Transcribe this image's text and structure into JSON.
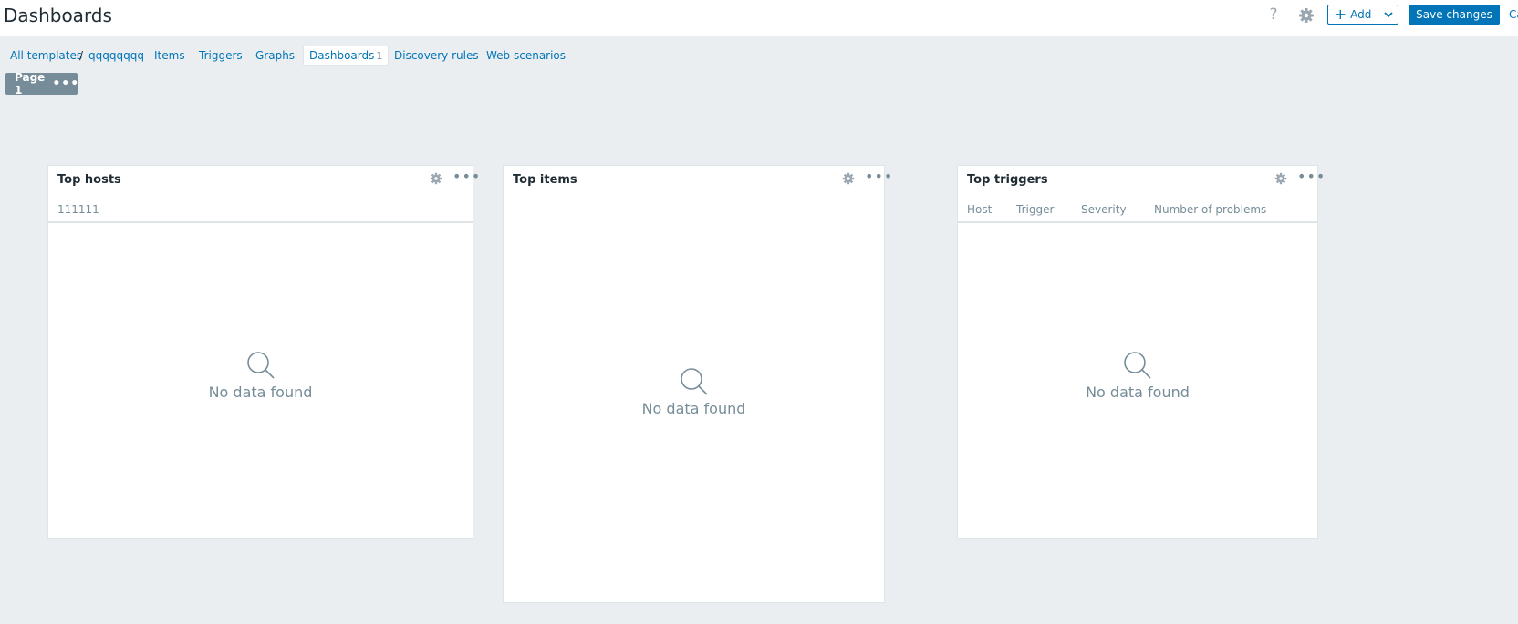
{
  "header": {
    "title": "Dashboards",
    "help_label": "?",
    "add_label": "Add",
    "save_label": "Save changes",
    "cancel_label": "Ca"
  },
  "nav": {
    "all_templates": "All templates",
    "separator": "/",
    "template_name": "qqqqqqqq",
    "items": "Items",
    "triggers": "Triggers",
    "graphs": "Graphs",
    "dashboards": "Dashboards",
    "dashboards_count": "1",
    "discovery_rules": "Discovery rules",
    "web_scenarios": "Web scenarios"
  },
  "page_tab": {
    "label": "Page 1",
    "menu": "•••"
  },
  "widgets": [
    {
      "title": "Top hosts",
      "columns": [
        "111111"
      ],
      "empty_text": "No data found",
      "menu": "•••"
    },
    {
      "title": "Top items",
      "columns": [],
      "empty_text": "No data found",
      "menu": "•••"
    },
    {
      "title": "Top triggers",
      "columns": [
        "Host",
        "Trigger",
        "Severity",
        "Number of problems"
      ],
      "empty_text": "No data found",
      "menu": "•••"
    }
  ],
  "colors": {
    "accent": "#0275b8",
    "background": "#ebeef0",
    "muted": "#768d99"
  }
}
